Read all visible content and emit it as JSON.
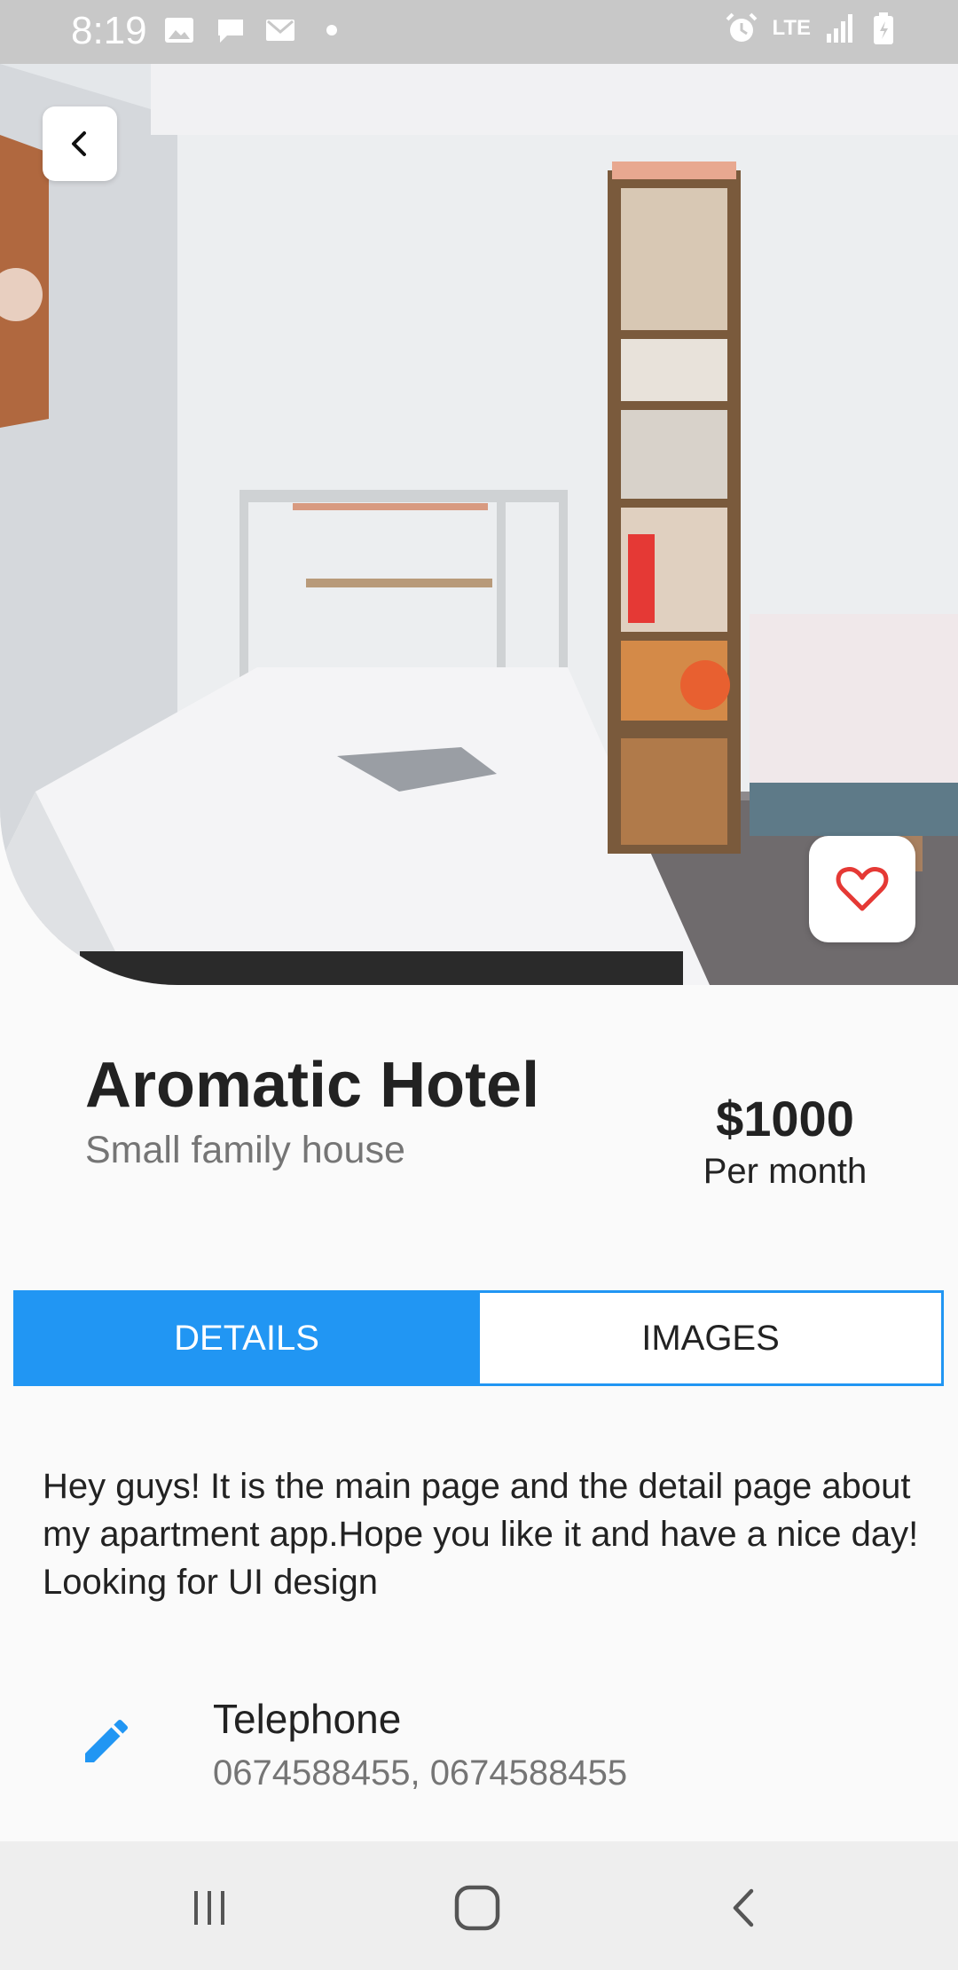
{
  "status_bar": {
    "time": "8:19",
    "network": "LTE",
    "icons": [
      "image-icon",
      "message-icon",
      "gmail-icon",
      "dot-icon",
      "alarm-icon",
      "lte-icon",
      "signal-icon",
      "battery-icon"
    ]
  },
  "hotel": {
    "name": "Aromatic Hotel",
    "subtitle": "Small family house",
    "price": "$1000",
    "price_period": "Per month"
  },
  "tabs": [
    {
      "label": "DETAILS",
      "active": true
    },
    {
      "label": "IMAGES",
      "active": false
    }
  ],
  "description": "Hey guys!  It is the main page and the detail page about my apartment app.Hope you like it and have a nice day!  Looking for UI design",
  "contact": {
    "title": "Telephone",
    "value": "0674588455,  0674588455",
    "icon": "pencil-icon"
  },
  "colors": {
    "accent": "#2196f3",
    "favorite": "#e53935",
    "status_bar": "#c8c8c8",
    "background": "#fafafa"
  }
}
